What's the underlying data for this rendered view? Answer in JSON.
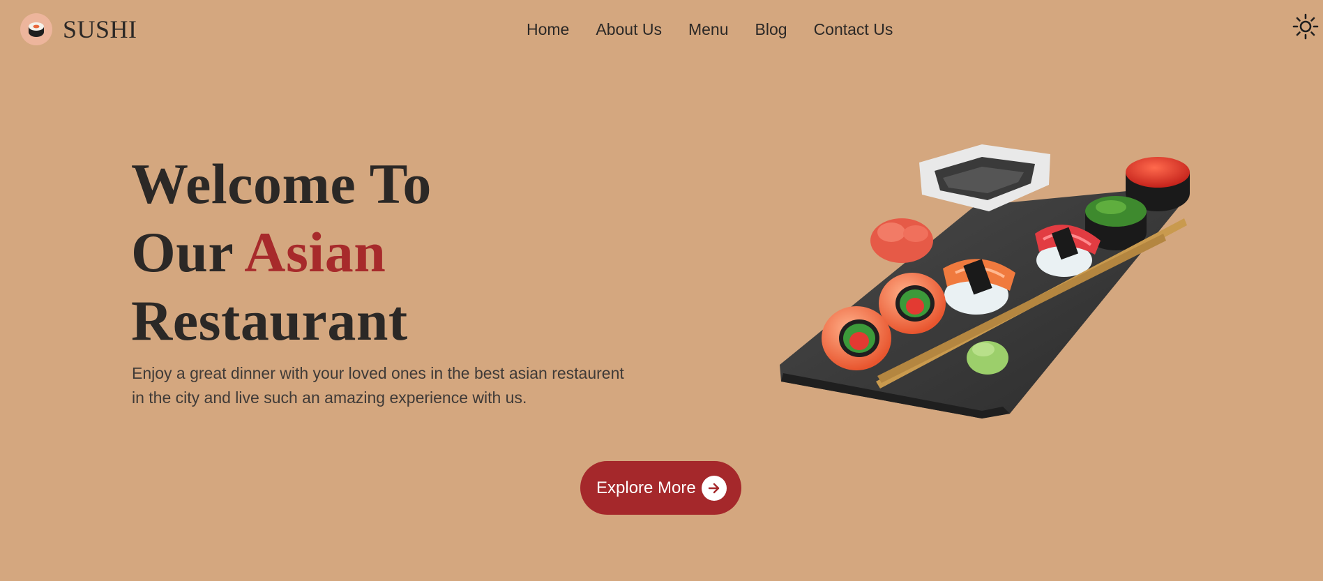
{
  "brand": {
    "name": "SUSHI",
    "logo_icon": "sushi-roll-icon"
  },
  "nav": {
    "items": [
      {
        "label": "Home"
      },
      {
        "label": "About Us"
      },
      {
        "label": "Menu"
      },
      {
        "label": "Blog"
      },
      {
        "label": "Contact Us"
      }
    ]
  },
  "theme_toggle": {
    "icon": "sun-icon"
  },
  "hero": {
    "title_line1": "Welcome To",
    "title_line2_prefix": "Our",
    "title_accent": "Asian",
    "title_line3": "Restaurant",
    "description": "Enjoy a great dinner with your loved ones in the best asian restaurent in the city and live such an amazing experience with us.",
    "button_label": "Explore More",
    "button_icon": "arrow-right-icon",
    "image_subject": "sushi-platter-illustration"
  },
  "colors": {
    "background": "#D4A77F",
    "accent": "#A72A2B",
    "button": "#A5282B",
    "text": "#2b2826"
  }
}
